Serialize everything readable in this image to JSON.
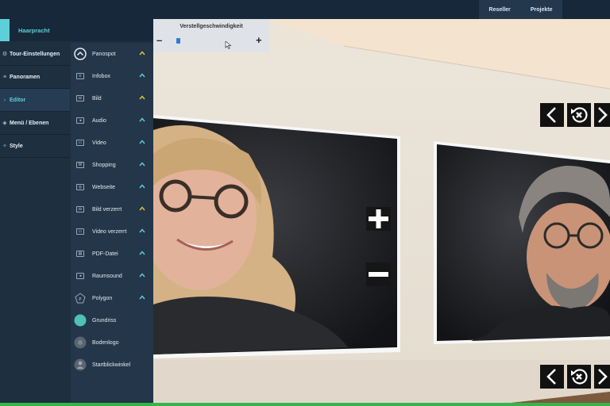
{
  "topbar": {
    "nav": [
      "Reseller",
      "Projekte"
    ]
  },
  "panel": {
    "title": "Haarpracht"
  },
  "menu": [
    {
      "label": "Tour-Einstellungen",
      "icon": "gear-icon",
      "glyph": "⚙"
    },
    {
      "label": "Panoramen",
      "icon": "list-icon",
      "glyph": "≡"
    },
    {
      "label": "Editor",
      "icon": "edit-icon",
      "glyph": "›",
      "active": true
    },
    {
      "label": "Menü / Ebenen",
      "icon": "layers-icon",
      "glyph": "◈"
    },
    {
      "label": "Style",
      "icon": "palette-icon",
      "glyph": "✧"
    }
  ],
  "tools": [
    {
      "label": "Panospot",
      "icon": "panospot-icon",
      "chevron": "yellow"
    },
    {
      "label": "Infobox",
      "icon": "infobox-icon",
      "chevron": "teal"
    },
    {
      "label": "Bild",
      "icon": "image-icon",
      "chevron": "yellow"
    },
    {
      "label": "Audio",
      "icon": "audio-icon",
      "chevron": "teal"
    },
    {
      "label": "Video",
      "icon": "video-icon",
      "chevron": "teal"
    },
    {
      "label": "Shopping",
      "icon": "shopping-icon",
      "chevron": "teal"
    },
    {
      "label": "Webseite",
      "icon": "website-icon",
      "chevron": "teal"
    },
    {
      "label": "Bild verzerrt",
      "icon": "image-distorted-icon",
      "chevron": "yellow"
    },
    {
      "label": "Video verzerrt",
      "icon": "video-distorted-icon",
      "chevron": "teal"
    },
    {
      "label": "PDF-Datei",
      "icon": "pdf-icon",
      "chevron": "teal"
    },
    {
      "label": "Raumsound",
      "icon": "surround-sound-icon",
      "chevron": "teal"
    },
    {
      "label": "Polygon",
      "icon": "polygon-icon",
      "chevron": "teal"
    },
    {
      "label": "Grundriss",
      "icon": "floorplan-icon"
    },
    {
      "label": "Bodenlogo",
      "icon": "floor-logo-icon"
    },
    {
      "label": "Startblickwinkel",
      "icon": "start-view-icon"
    }
  ],
  "speed": {
    "title": "Verstellgeschwindigkeit",
    "minus": "–",
    "plus": "+"
  },
  "colors": {
    "accent": "#5ecfd6",
    "chevron_yellow": "#e3c23a",
    "chevron_teal": "#5ecfd6",
    "green": "#36b44a"
  }
}
